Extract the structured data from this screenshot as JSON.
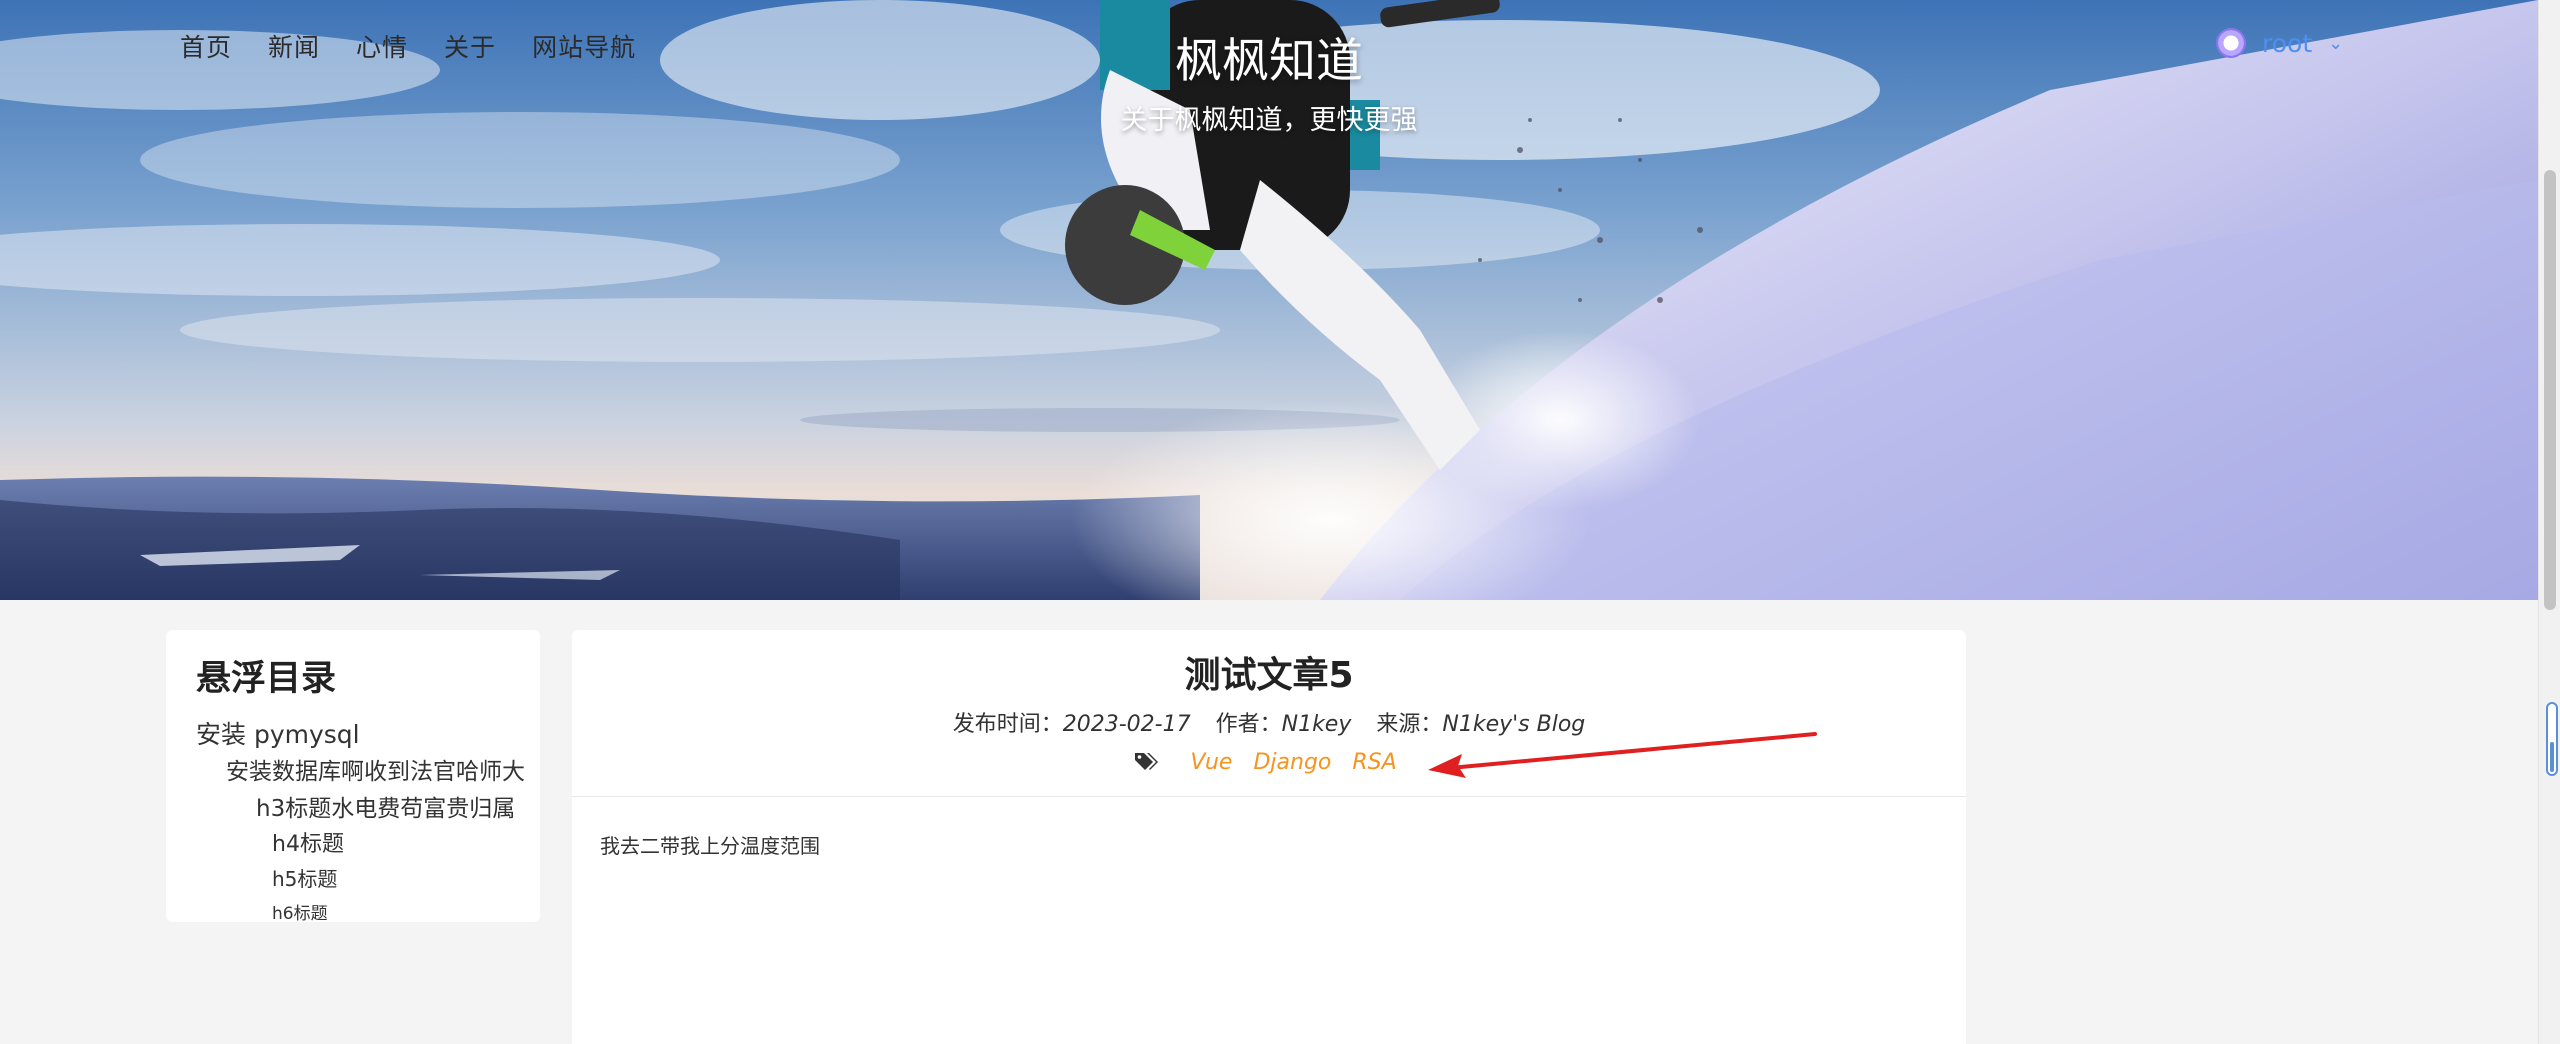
{
  "nav": {
    "items": [
      "首页",
      "新闻",
      "心情",
      "关于",
      "网站导航"
    ]
  },
  "site": {
    "title": "枫枫知道",
    "subtitle": "关于枫枫知道，更快更强"
  },
  "user": {
    "name": "root",
    "avatar_icon": "avatar-ring",
    "caret_icon": "chevron-down-icon"
  },
  "toc": {
    "title": "悬浮目录",
    "items": [
      {
        "level": 1,
        "text": "安装 pymysql"
      },
      {
        "level": 2,
        "text": "安装数据库啊收到法官哈师大"
      },
      {
        "level": 3,
        "text": "h3标题水电费苟富贵归属"
      },
      {
        "level": 4,
        "text": "h4标题"
      },
      {
        "level": 5,
        "text": "h5标题"
      },
      {
        "level": 6,
        "text": "h6标题"
      }
    ]
  },
  "article": {
    "title": "测试文章5",
    "meta": {
      "publish_label": "发布时间：",
      "publish_date": "2023-02-17",
      "author_label": "作者：",
      "author": "N1key",
      "source_label": "来源：",
      "source": "N1key's Blog"
    },
    "tag_icon": "tags-icon",
    "tags": [
      "Vue",
      "Django",
      "RSA"
    ],
    "body": "我去二带我上分温度范围"
  },
  "colors": {
    "tag": "#f7931e",
    "user": "#4e8ff3",
    "annotation_arrow": "#e02020"
  }
}
